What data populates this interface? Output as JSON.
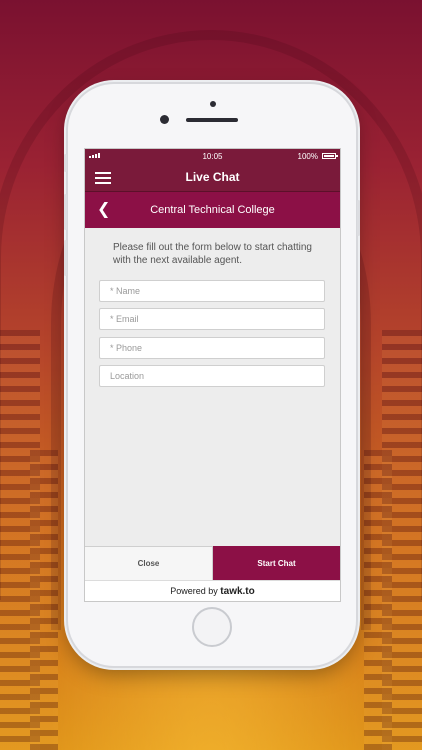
{
  "status_bar": {
    "time": "10:05",
    "battery": "100%"
  },
  "header": {
    "title": "Live Chat",
    "menu_icon": "hamburger-menu-icon"
  },
  "college_bar": {
    "title": "Central Technical College",
    "back_icon": "chevron-left-icon"
  },
  "form": {
    "intro": "Please fill out the form below to start chatting with the next available agent.",
    "name_placeholder": "* Name",
    "email_placeholder": "* Email",
    "phone_placeholder": "* Phone",
    "location_placeholder": "Location"
  },
  "actions": {
    "close_label": "Close",
    "start_label": "Start Chat"
  },
  "footer": {
    "powered_prefix": "Powered by",
    "brand": "tawk.to"
  },
  "colors": {
    "header": "#7a1a3a",
    "accent": "#8c1046",
    "screen_bg": "#ededed"
  }
}
